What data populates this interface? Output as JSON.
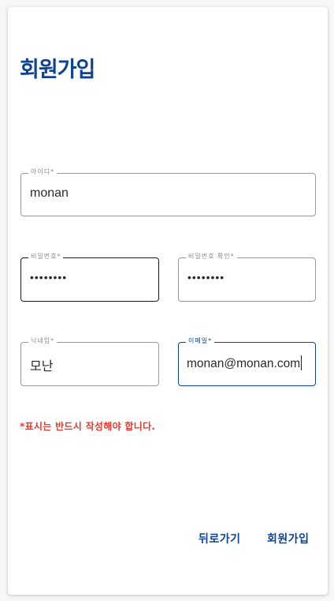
{
  "page": {
    "title": "회원가입"
  },
  "fields": {
    "id": {
      "label": "아이디*",
      "value": "monan"
    },
    "password": {
      "label": "비밀번호*",
      "value": "••••••••"
    },
    "password_confirm": {
      "label": "비밀번호 확인*",
      "value": "••••••••"
    },
    "nickname": {
      "label": "닉네임*",
      "value": "모난"
    },
    "email": {
      "label": "이메일*",
      "value": "monan@monan.com"
    }
  },
  "notice": "*표시는 반드시 작성해야 합니다.",
  "actions": {
    "back_label": "뒤로가기",
    "signup_label": "회원가입"
  },
  "colors": {
    "accent": "#0d4392",
    "warning": "#e8382e"
  }
}
